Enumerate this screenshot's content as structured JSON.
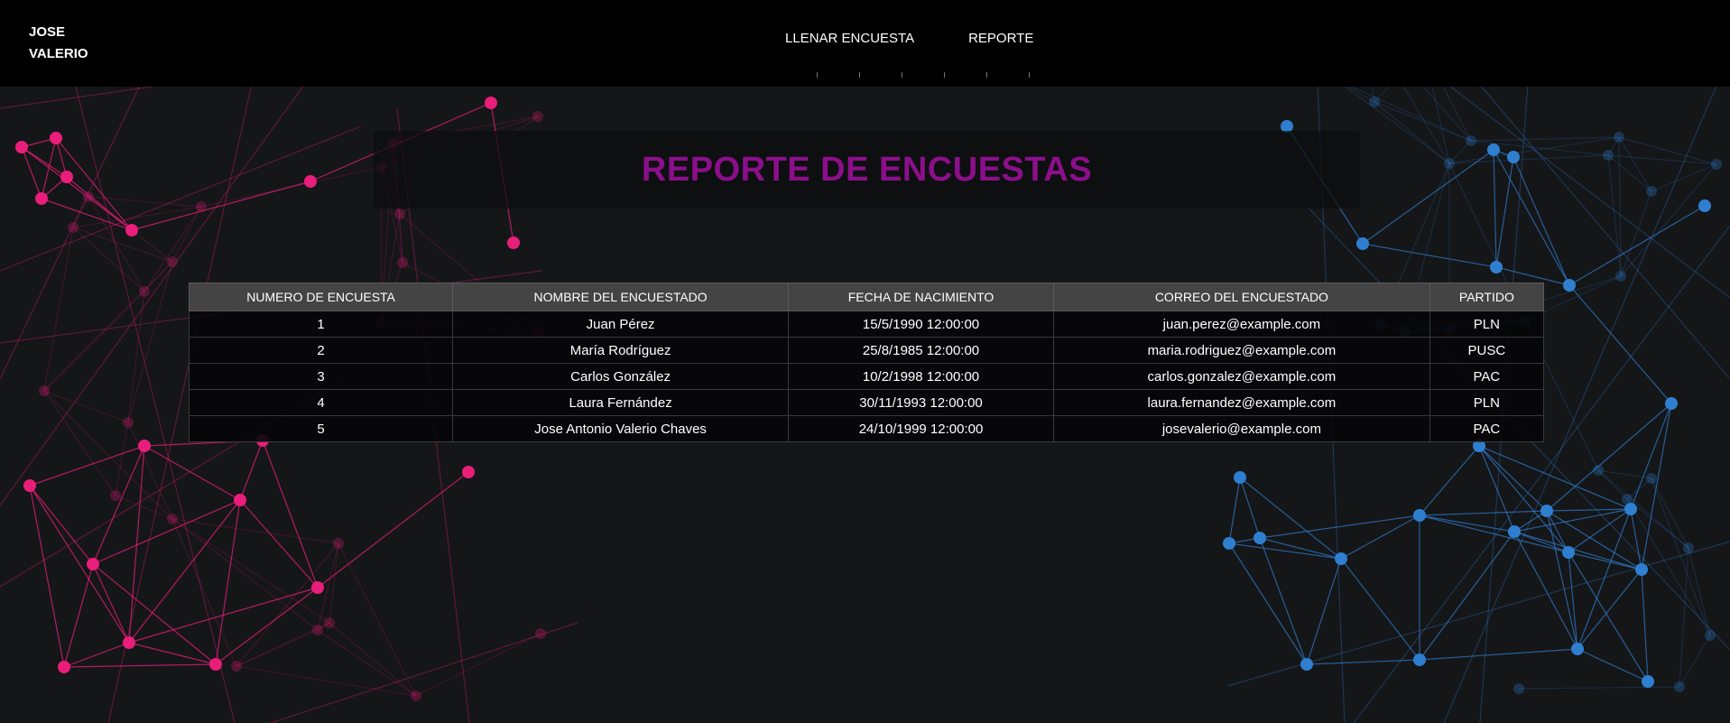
{
  "header": {
    "brand_line1": "JOSE",
    "brand_line2": "VALERIO",
    "nav": [
      "LLENAR ENCUESTA",
      "REPORTE"
    ]
  },
  "page_title": "REPORTE DE ENCUESTAS",
  "table": {
    "headers": [
      "NUMERO DE ENCUESTA",
      "NOMBRE DEL ENCUESTADO",
      "FECHA DE NACIMIENTO",
      "CORREO DEL ENCUESTADO",
      "PARTIDO"
    ],
    "rows": [
      [
        "1",
        "Juan Pérez",
        "15/5/1990 12:00:00",
        "juan.perez@example.com",
        "PLN"
      ],
      [
        "2",
        "María Rodríguez",
        "25/8/1985 12:00:00",
        "maria.rodriguez@example.com",
        "PUSC"
      ],
      [
        "3",
        "Carlos González",
        "10/2/1998 12:00:00",
        "carlos.gonzalez@example.com",
        "PAC"
      ],
      [
        "4",
        "Laura Fernández",
        "30/11/1993 12:00:00",
        "laura.fernandez@example.com",
        "PLN"
      ],
      [
        "5",
        "Jose Antonio Valerio Chaves",
        "24/10/1999 12:00:00",
        "josevalerio@example.com",
        "PAC"
      ]
    ]
  },
  "colors": {
    "background": "#151618",
    "header_bg": "#000000",
    "title": "#8b0f8b",
    "table_header_bg": "#444444",
    "network_pink": "#e91e7a",
    "network_blue": "#2f7fd0"
  }
}
